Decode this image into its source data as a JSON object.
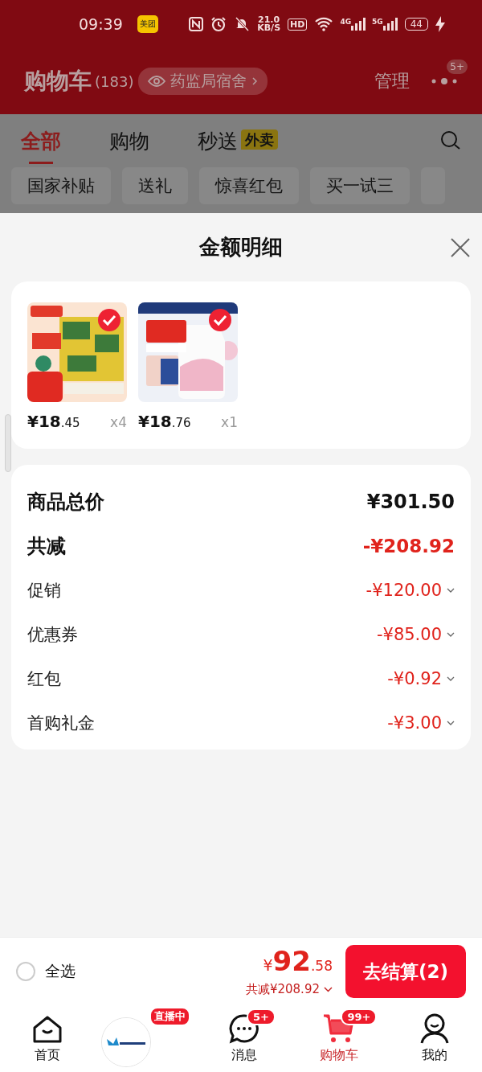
{
  "status_bar": {
    "time": "09:39",
    "app_badge": "美团",
    "net_speed": "21.0",
    "net_unit": "KB/S",
    "hd": "HD",
    "net_4g": "4G",
    "net_5g": "5G",
    "battery": "44"
  },
  "header": {
    "title": "购物车",
    "count": "(183)",
    "address": "药监局宿舍",
    "manage": "管理",
    "more_badge": "5+"
  },
  "tabs": [
    {
      "label": "全部",
      "selected": true
    },
    {
      "label": "购物",
      "selected": false
    },
    {
      "label": "秒送",
      "selected": false,
      "tag": "外卖"
    }
  ],
  "filters": [
    "国家补贴",
    "送礼",
    "惊喜红包",
    "买一试三"
  ],
  "sheet": {
    "title": "金额明细",
    "items": [
      {
        "kind": "tissue",
        "price": "¥18",
        "price_cents": ".45",
        "qty": "x4",
        "checked": true
      },
      {
        "kind": "bottle",
        "price": "¥18",
        "price_cents": ".76",
        "qty": "x1",
        "checked": true
      }
    ],
    "summary": [
      {
        "kind": "total",
        "label": "商品总价",
        "value": "¥301.50"
      },
      {
        "kind": "discount",
        "label": "共减",
        "value": "-¥208.92"
      },
      {
        "kind": "detail",
        "label": "促销",
        "value": "-¥120.00"
      },
      {
        "kind": "detail",
        "label": "优惠券",
        "value": "-¥85.00"
      },
      {
        "kind": "detail",
        "label": "红包",
        "value": "-¥0.92"
      },
      {
        "kind": "detail",
        "label": "首购礼金",
        "value": "-¥3.00"
      }
    ]
  },
  "bottom": {
    "select_all": {
      "label": "全选",
      "checked": false
    },
    "currency": "¥",
    "price": "92",
    "price_cents": ".58",
    "saving": "共减¥208.92",
    "checkout": "去结算(2)"
  },
  "nav": [
    {
      "kind": "home",
      "label": "首页",
      "selected": false
    },
    {
      "kind": "live",
      "badge": "直播中"
    },
    {
      "kind": "messages",
      "label": "消息",
      "badge": "5+",
      "selected": false
    },
    {
      "kind": "cart",
      "label": "购物车",
      "badge": "99+",
      "selected": true
    },
    {
      "kind": "me",
      "label": "我的",
      "selected": false
    }
  ]
}
